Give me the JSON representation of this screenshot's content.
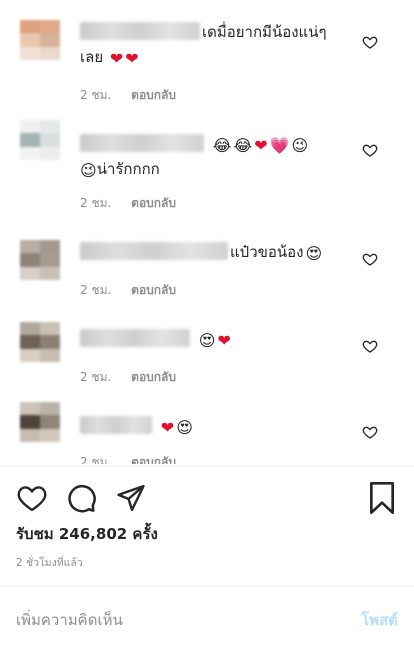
{
  "comments": [
    {
      "text_lines": [
        "เดมื่อยากมีน้องแน่ๆ",
        "เลย"
      ],
      "emojis_line1": [],
      "emojis_line2": [
        "heart-red",
        "heart-red"
      ],
      "time": "2 ชม.",
      "reply": "ตอบกลับ",
      "avatar_colors": [
        "#dca07c",
        "#e0a989",
        "#e9c7ad",
        "#d7b29a",
        "#efe1d6",
        "#e9d8cb"
      ]
    },
    {
      "text_lines": [
        "",
        "น่ารักกกก"
      ],
      "emojis_line1": [
        "joy",
        "joy",
        "heart-red",
        "heart-pink",
        "wink"
      ],
      "emojis_line2": [
        "wink"
      ],
      "time": "2 ชม.",
      "reply": "ตอบกลับ",
      "avatar_colors": [
        "#eef0f0",
        "#e4e8e8",
        "#a6b3b3",
        "#d9dfdf",
        "#f1f2f2",
        "#eceeee"
      ]
    },
    {
      "text_lines": [
        "แป๋วขอน้อง"
      ],
      "emojis_line1": [
        "heart-eyes"
      ],
      "time": "2 ชม.",
      "reply": "ตอบกลับ",
      "avatar_colors": [
        "#b7aea4",
        "#a19990",
        "#8d847a",
        "#a59c93",
        "#d7d0c9",
        "#c9c1b8"
      ]
    },
    {
      "text_lines": [
        ""
      ],
      "emojis_line1": [
        "heart-eyes",
        "heart-red"
      ],
      "time": "2 ชม.",
      "reply": "ตอบกลับ",
      "avatar_colors": [
        "#b0a89c",
        "#c9c1b4",
        "#6f6357",
        "#8c8073",
        "#d8d0c3",
        "#c6beb2"
      ]
    },
    {
      "text_lines": [
        ""
      ],
      "emojis_line1": [
        "heart-red",
        "heart-eyes"
      ],
      "time": "2 ชม.",
      "reply": "ตอบกลับ",
      "avatar_colors": [
        "#ccc4b9",
        "#bab2a7",
        "#4d453d",
        "#8f8579",
        "#c7beb3",
        "#d1c8bd"
      ]
    }
  ],
  "likes": "รับชม 246,802 ครั้ง",
  "timestamp": "2 ชั่วโมงที่แล้ว",
  "add_comment": {
    "placeholder": "เพิ่มความคิดเห็น",
    "post_label": "โพสต์"
  },
  "colors": {
    "post_disabled": "#b2dffc",
    "heart_red": "#e0102f",
    "meta_gray": "#8e8e8e"
  }
}
